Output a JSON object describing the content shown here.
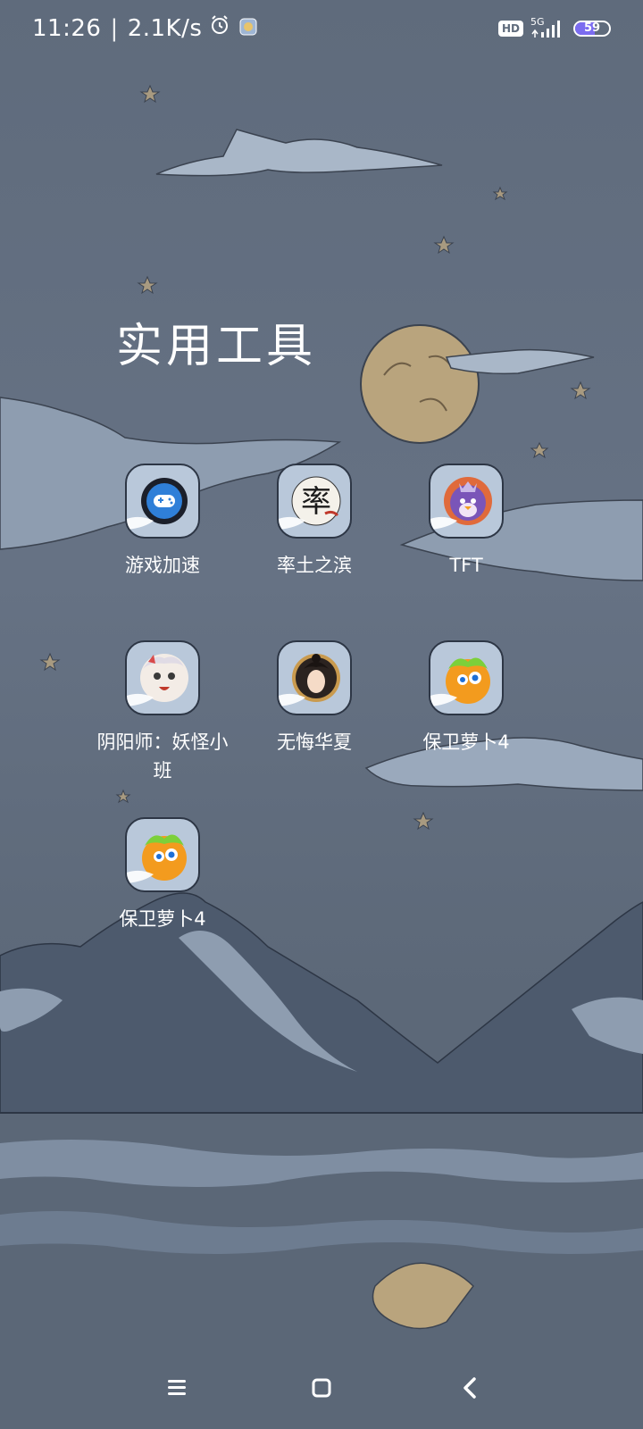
{
  "status_bar": {
    "time": "11:26",
    "separator": "|",
    "net_speed": "2.1K/s",
    "hd_label": "HD",
    "network_type": "5G",
    "battery_level": "59",
    "battery_fraction": 0.59
  },
  "folder": {
    "title": "实用工具",
    "apps": [
      {
        "label": "游戏加速",
        "icon": "game-controller-icon"
      },
      {
        "label": "率土之滨",
        "icon": "shuaitu-logo-icon"
      },
      {
        "label": "TFT",
        "icon": "tft-penguin-icon"
      },
      {
        "label": "阴阳师：妖怪小班",
        "icon": "onmyoji-character-icon"
      },
      {
        "label": "无悔华夏",
        "icon": "wuhui-huaxia-icon"
      },
      {
        "label": "保卫萝卜4",
        "icon": "carrot-defense-icon"
      },
      {
        "label": "保卫萝卜4",
        "icon": "carrot-defense-icon"
      }
    ]
  },
  "nav_bar": {
    "menu_icon": "menu-icon",
    "home_icon": "home-icon",
    "back_icon": "back-icon"
  },
  "colors": {
    "background": "#5f6b7c",
    "icon_backdrop": "#b9c8da",
    "moon": "#b9a47d",
    "text": "#ffffff"
  }
}
